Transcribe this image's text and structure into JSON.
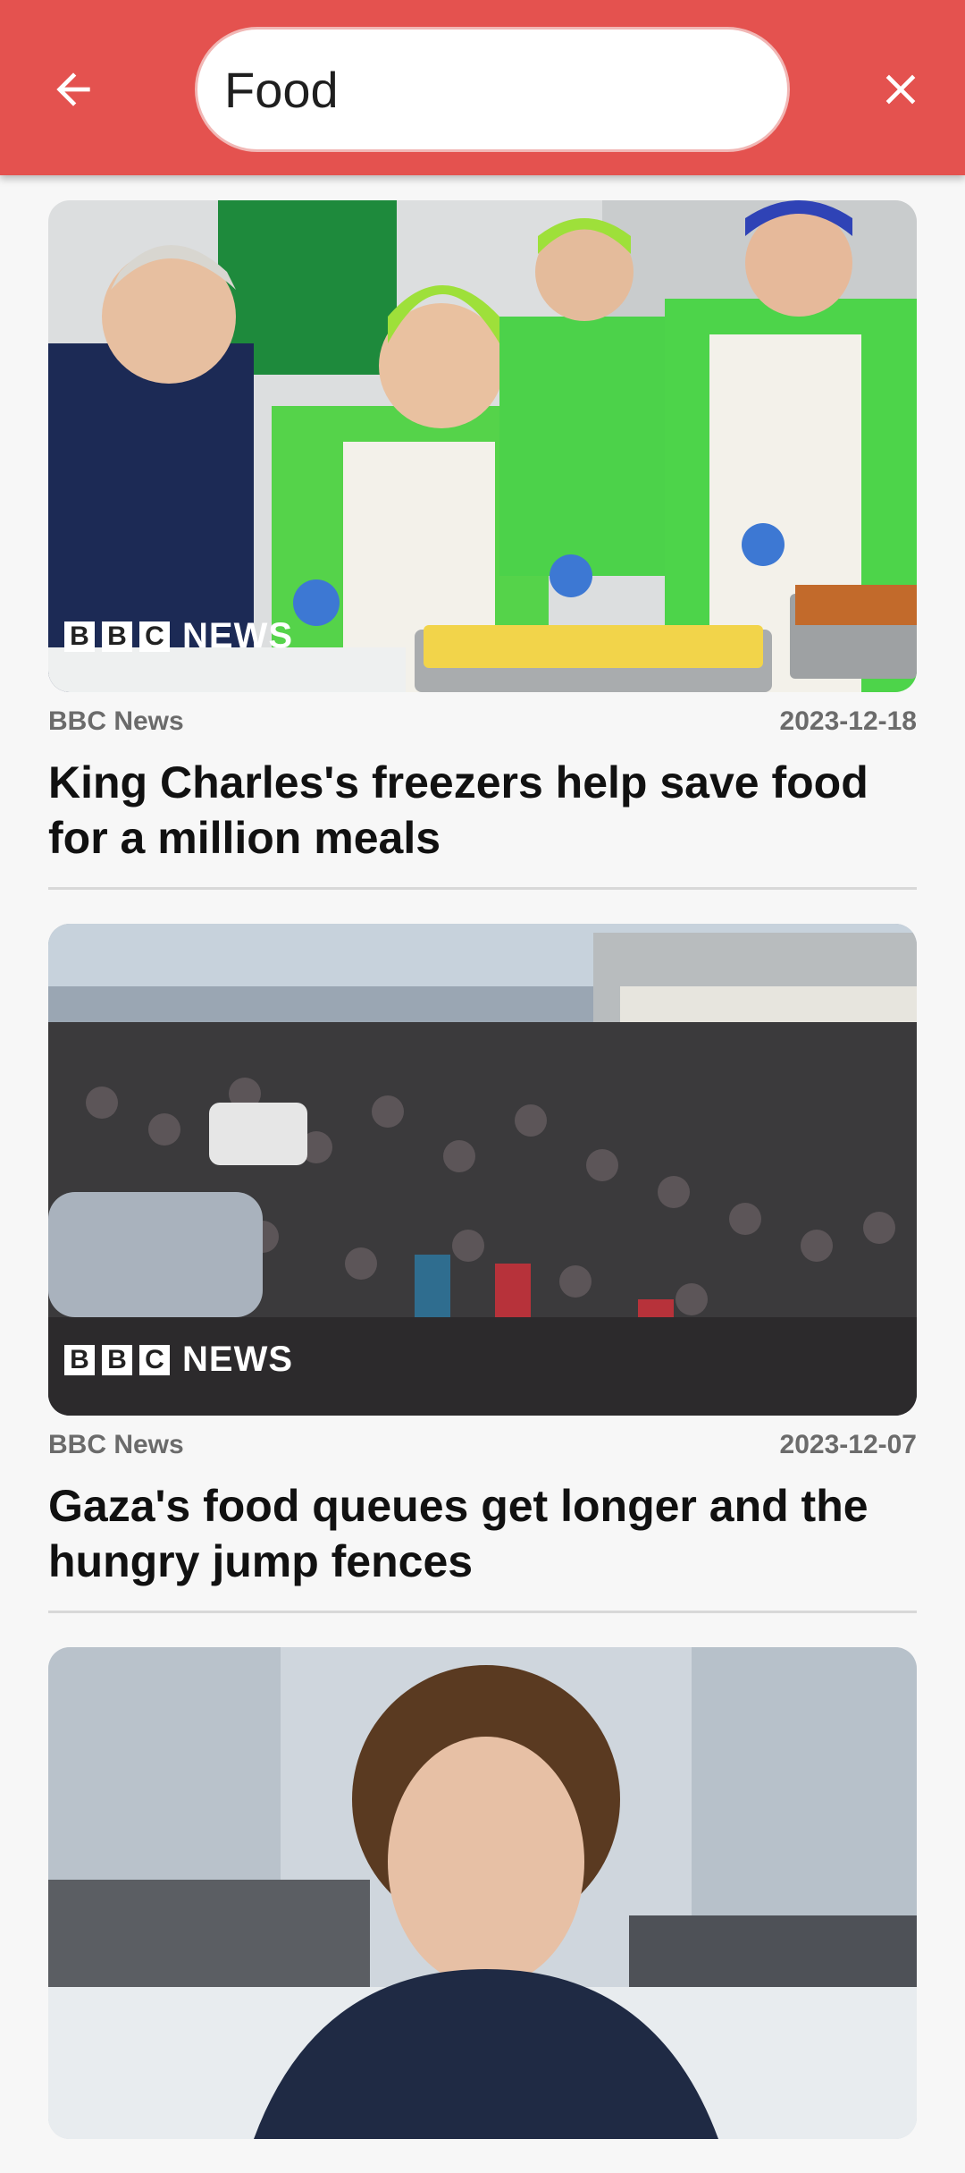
{
  "header": {
    "search_value": "Food",
    "back_icon": "arrow-left-icon",
    "close_icon": "close-icon",
    "accent_color": "#e4524f"
  },
  "articles": [
    {
      "source": "BBC News",
      "date": "2023-12-18",
      "title": "King Charles's freezers help save food for a million meals",
      "logo_blocks": [
        "B",
        "B",
        "C"
      ],
      "logo_word": "NEWS"
    },
    {
      "source": "BBC News",
      "date": "2023-12-07",
      "title": "Gaza's food queues get longer and the hungry jump fences",
      "logo_blocks": [
        "B",
        "B",
        "C"
      ],
      "logo_word": "NEWS"
    },
    {
      "source": "",
      "date": "",
      "title": ""
    }
  ]
}
